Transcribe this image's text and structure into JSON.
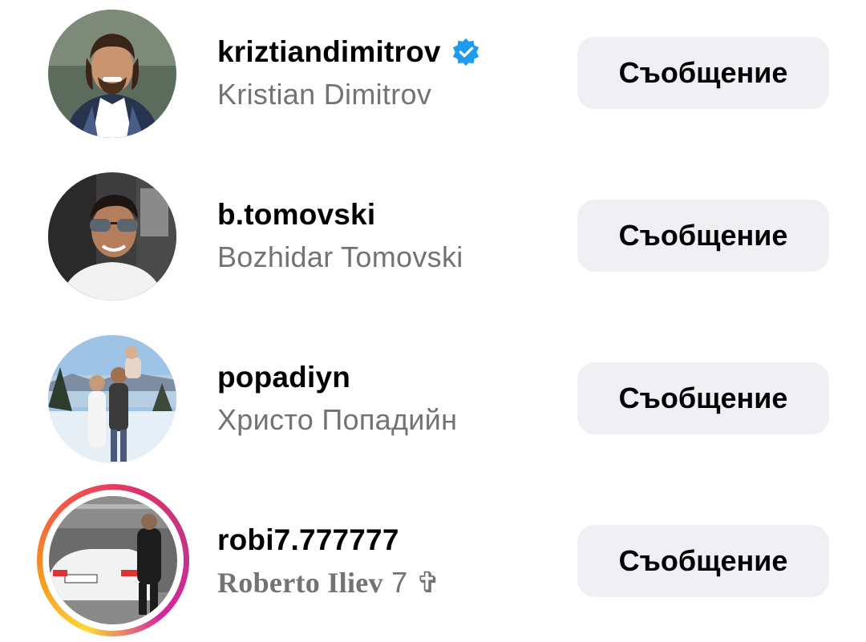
{
  "accounts": [
    {
      "username": "kriztiandimitrov",
      "full_name": "Kristian Dimitrov",
      "verified": true,
      "has_story": false,
      "button_label": "Съобщение"
    },
    {
      "username": "b.tomovski",
      "full_name": "Bozhidar Tomovski",
      "verified": false,
      "has_story": false,
      "button_label": "Съобщение"
    },
    {
      "username": "popadiyn",
      "full_name": "Христо Попадийн",
      "verified": false,
      "has_story": false,
      "button_label": "Съобщение"
    },
    {
      "username": "robi7.777777",
      "full_name_styled": "Roberto Iliev",
      "full_name_suffix": " 7 ✞",
      "verified": false,
      "has_story": true,
      "button_label": "Съобщение"
    }
  ],
  "colors": {
    "verified_badge": "#1d9bf0",
    "button_bg": "#efeff4",
    "secondary_text": "#737373"
  },
  "icons": {
    "verified": "verified-badge-icon"
  }
}
